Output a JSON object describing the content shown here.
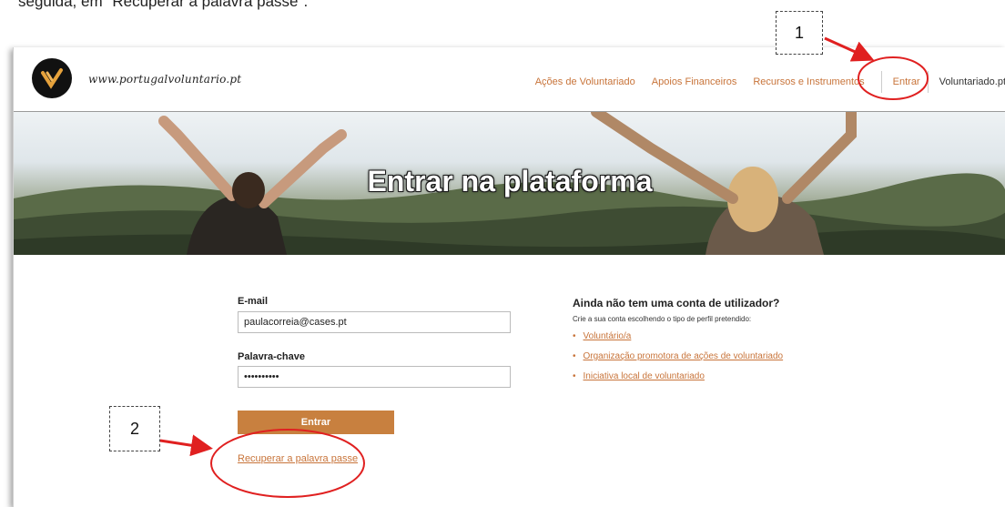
{
  "doc_text": "seguida, em \"Recuperar a palavra passe\".",
  "site": {
    "logo_text": "www.portugalvoluntario.pt",
    "nav": [
      "Ações de Voluntariado",
      "Apoios Financeiros",
      "Recursos e Instrumentos"
    ],
    "login_link": "Entrar",
    "site_name": "Voluntariado.pt"
  },
  "hero": {
    "title": "Entrar na plataforma"
  },
  "login_form": {
    "email_label": "E-mail",
    "email_value": "paulacorreia@cases.pt",
    "password_label": "Palavra-chave",
    "password_value": "••••••••••",
    "submit_label": "Entrar",
    "recover_label": "Recuperar a palavra passe"
  },
  "register": {
    "title": "Ainda não tem uma conta de utilizador?",
    "subtitle": "Crie a sua conta escolhendo o tipo de perfil pretendido:",
    "types": [
      "Voluntário/a",
      "Organização promotora de ações de voluntariado",
      "Iniciativa local de voluntariado"
    ]
  },
  "annotations": {
    "step_1": "1",
    "step_2": "2",
    "accent_color": "#e02020"
  }
}
